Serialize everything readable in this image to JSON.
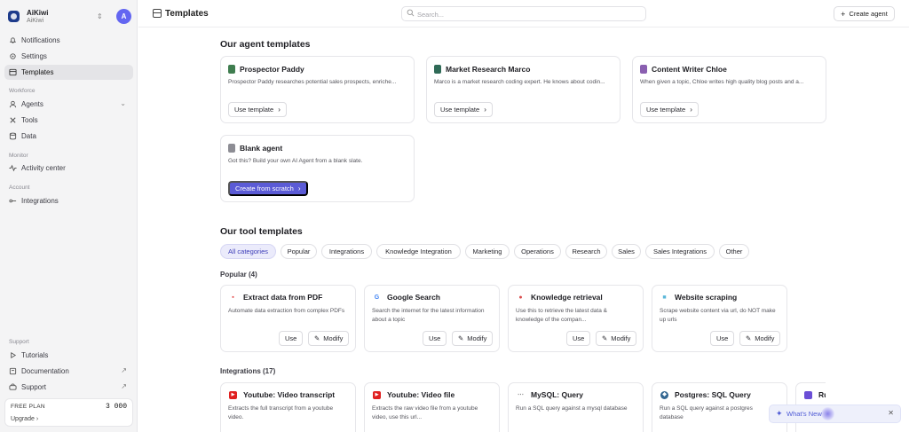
{
  "workspace": {
    "name": "AiKiwi",
    "subtitle": "AiKiwi",
    "avatar_letter": "A"
  },
  "sidebar": {
    "items": [
      {
        "label": "Notifications",
        "icon": "bell-icon"
      },
      {
        "label": "Settings",
        "icon": "gear-icon"
      },
      {
        "label": "Templates",
        "icon": "templates-icon",
        "active": true
      }
    ],
    "sections": {
      "workforce": "Workforce",
      "monitor": "Monitor",
      "account": "Account",
      "support": "Support"
    },
    "workforce_items": [
      {
        "label": "Agents",
        "icon": "agents-icon"
      },
      {
        "label": "Tools",
        "icon": "tools-icon"
      },
      {
        "label": "Data",
        "icon": "database-icon"
      }
    ],
    "monitor_items": [
      {
        "label": "Activity center",
        "icon": "activity-icon"
      }
    ],
    "account_items": [
      {
        "label": "Integrations",
        "icon": "integrations-icon"
      }
    ],
    "support_items": [
      {
        "label": "Tutorials",
        "icon": "play-icon"
      },
      {
        "label": "Documentation",
        "icon": "book-icon"
      },
      {
        "label": "Support",
        "icon": "support-icon"
      }
    ],
    "plan": {
      "label": "FREE PLAN",
      "credits": "3 000",
      "upgrade": "Upgrade"
    }
  },
  "header": {
    "title": "Templates",
    "search_placeholder": "Search...",
    "create_label": "Create agent"
  },
  "agent_section": {
    "title": "Our agent templates",
    "cards": [
      {
        "title": "Prospector Paddy",
        "desc": "Prospector Paddy researches potential sales prospects, enriche...",
        "button": "Use template",
        "color": "#3f7d4f"
      },
      {
        "title": "Market Research Marco",
        "desc": "Marco is a market research coding expert. He knows about codin...",
        "button": "Use template",
        "color": "#2f6a57"
      },
      {
        "title": "Content Writer Chloe",
        "desc": "When given a topic, Chloe writes high quality blog posts and a...",
        "button": "Use template",
        "color": "#8a5fb0"
      }
    ],
    "blank": {
      "title": "Blank agent",
      "desc": "Got this? Build your own AI Agent from a blank slate.",
      "button": "Create from scratch"
    }
  },
  "tool_section": {
    "title": "Our tool templates",
    "categories": [
      "All categories",
      "Popular",
      "Integrations",
      "Knowledge Integration",
      "Marketing",
      "Operations",
      "Research",
      "Sales",
      "Sales Integrations",
      "Other"
    ],
    "popular_heading": "Popular (4)",
    "popular": [
      {
        "title": "Extract data from PDF",
        "desc": "Automate data extraction from complex PDFs",
        "icon": "pdf-icon",
        "glyph": "▪",
        "color": "#e03a3a"
      },
      {
        "title": "Google Search",
        "desc": "Search the internet for the latest information about a topic",
        "icon": "google-icon",
        "glyph": "G",
        "color": "#4285f4"
      },
      {
        "title": "Knowledge retrieval",
        "desc": "Use this to retrieve the latest data & knowledge of the compan...",
        "icon": "knowledge-icon",
        "glyph": "●",
        "color": "#d94b4b"
      },
      {
        "title": "Website scraping",
        "desc": "Scrape website content via url, do NOT make up urls",
        "icon": "scrape-icon",
        "glyph": "■",
        "color": "#5bb7d9"
      }
    ],
    "use_label": "Use",
    "modify_label": "Modify",
    "integrations_heading": "Integrations (17)",
    "integrations": [
      {
        "title": "Youtube: Video transcript",
        "desc": "Extracts the full transcript from a youtube video.",
        "icon": "youtube-icon",
        "color": "#e02020"
      },
      {
        "title": "Youtube: Video file",
        "desc": "Extracts the raw video file from a youtube video, use this url...",
        "icon": "youtube-icon",
        "color": "#e02020"
      },
      {
        "title": "MySQL: Query",
        "desc": "Run a SQL query against a mysql database",
        "icon": "mysql-icon",
        "color": "#8a8a8a"
      },
      {
        "title": "Postgres: SQL Query",
        "desc": "Run a SQL query against a postgres database",
        "icon": "postgres-icon",
        "color": "#336791"
      },
      {
        "title": "Ru",
        "desc": "",
        "icon": "integration-icon",
        "color": "#6b4fd6"
      }
    ]
  },
  "whats_new": {
    "label": "What's New",
    "icon": "sparkle-icon"
  }
}
